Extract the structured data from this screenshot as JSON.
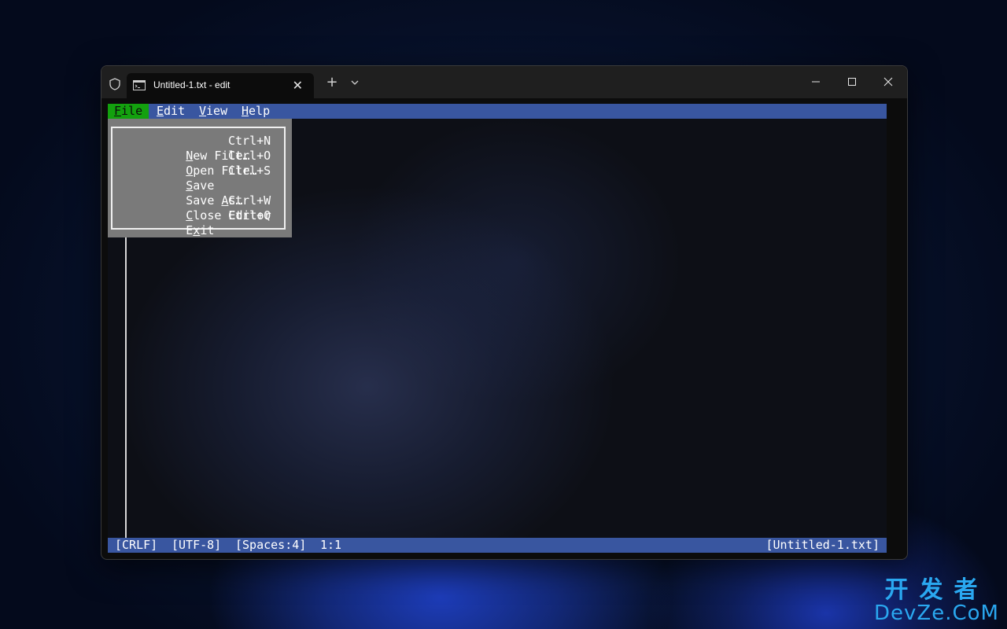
{
  "window": {
    "tab_title": "Untitled-1.txt - edit",
    "tab_close": "✕",
    "new_tab": "+",
    "controls": [
      "minimize-icon",
      "maximize-icon",
      "close-icon"
    ]
  },
  "menubar": {
    "items": [
      {
        "label": "File",
        "accelerator": "F",
        "rest": "ile",
        "active": true
      },
      {
        "label": "Edit",
        "accelerator": "E",
        "rest": "dit",
        "active": false
      },
      {
        "label": "View",
        "accelerator": "V",
        "rest": "iew",
        "active": false
      },
      {
        "label": "Help",
        "accelerator": "H",
        "rest": "elp",
        "active": false
      }
    ]
  },
  "file_menu": {
    "items": [
      {
        "pre": "",
        "acc": "N",
        "post": "ew File…",
        "shortcut": "Ctrl+N"
      },
      {
        "pre": "",
        "acc": "O",
        "post": "pen File…",
        "shortcut": "Ctrl+O"
      },
      {
        "pre": "",
        "acc": "S",
        "post": "ave",
        "shortcut": "Ctrl+S"
      },
      {
        "pre": "Save ",
        "acc": "A",
        "post": "s…",
        "shortcut": ""
      },
      {
        "pre": "",
        "acc": "C",
        "post": "lose Editor",
        "shortcut": "Ctrl+W"
      },
      {
        "pre": "E",
        "acc": "x",
        "post": "it",
        "shortcut": "Ctrl+Q"
      }
    ]
  },
  "statusbar": {
    "line_ending": "[CRLF]",
    "encoding": "[UTF-8]",
    "indentation": "[Spaces:4]",
    "position": "1:1",
    "filename": "[Untitled-1.txt]"
  },
  "watermark": {
    "line1": "开发者",
    "line2": "DevZe.CoM"
  },
  "colors": {
    "menubar_bg": "#3956a0",
    "menu_active_bg": "#13a10e",
    "dropdown_bg": "#7a7a7a",
    "titlebar_bg": "#1f1f1f",
    "watermark": "#2aa8f0"
  }
}
